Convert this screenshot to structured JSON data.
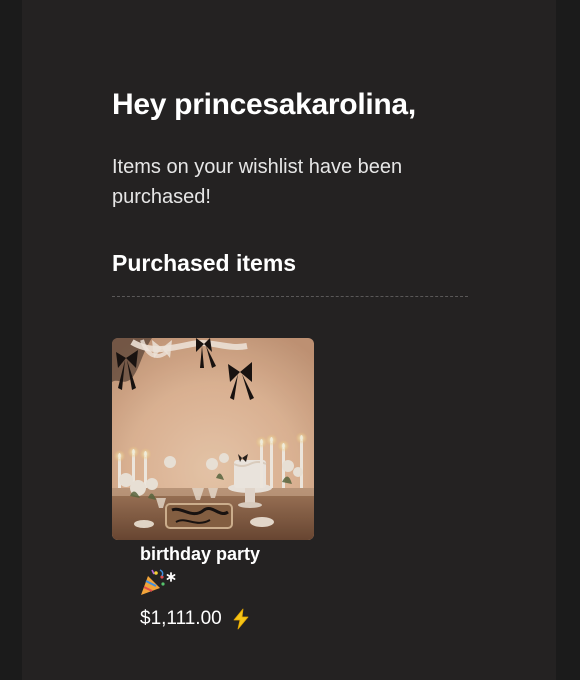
{
  "email": {
    "greeting": "Hey princesakarolina,",
    "message": "Items on your wishlist have been purchased!",
    "section_title": "Purchased items"
  },
  "items": [
    {
      "name": "birthday party",
      "emoji_icon": "party-popper-sparkle-icon",
      "price": "$1,111.00",
      "price_icon": "lightning-bolt-icon"
    }
  ],
  "colors": {
    "background": "#242222",
    "text": "#ffffff",
    "bolt": "#f5c518"
  }
}
